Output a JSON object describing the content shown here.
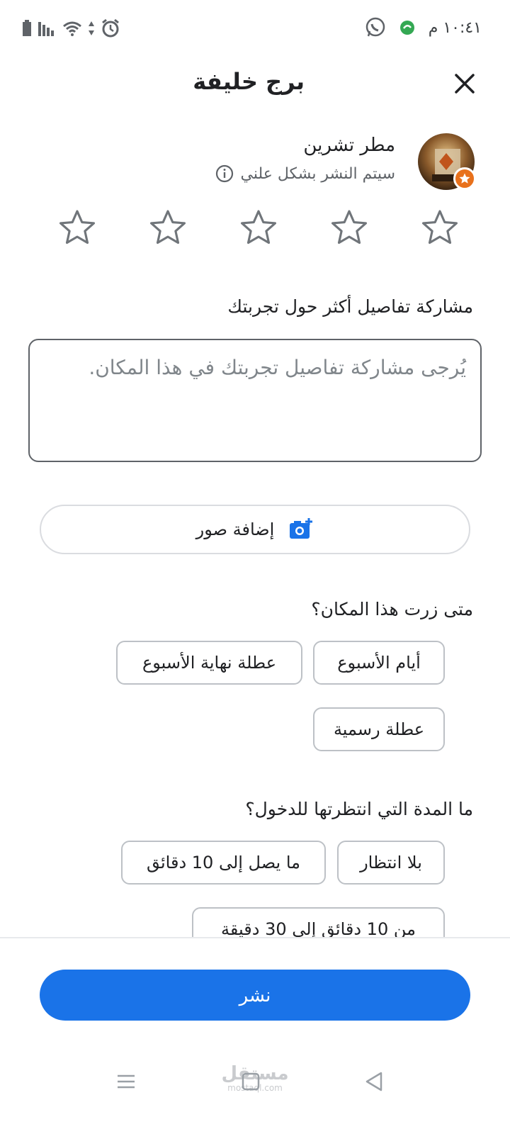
{
  "status_bar": {
    "time": "١٠:٤١ م",
    "icons": [
      "battery-icon",
      "signal-icon",
      "wifi-icon",
      "data-arrows-icon",
      "alarm-icon",
      "whatsapp-icon",
      "app-notification-icon"
    ]
  },
  "header": {
    "title": "برج خليفة",
    "close_icon": "close-icon"
  },
  "profile": {
    "name": "مطر تشرين",
    "post_note": "سيتم النشر بشكل علني",
    "info_icon": "info-icon",
    "badge_icon": "local-guide-star-icon"
  },
  "rating": {
    "max_stars": 5,
    "selected": 0
  },
  "review": {
    "label": "مشاركة تفاصيل أكثر حول تجربتك",
    "placeholder": "يُرجى مشاركة تفاصيل تجربتك في هذا المكان."
  },
  "add_photos": {
    "label": "إضافة صور",
    "icon": "add-photo-icon"
  },
  "visit_time": {
    "question": "متى زرت هذا المكان؟",
    "options": [
      "أيام الأسبوع",
      "عطلة نهاية الأسبوع",
      "عطلة رسمية"
    ]
  },
  "wait_time": {
    "question": "ما المدة التي انتظرتها للدخول؟",
    "options": [
      "بلا انتظار",
      "ما يصل إلى 10 دقائق",
      "من 10 دقائق إلى 30 دقيقة"
    ]
  },
  "publish": {
    "label": "نشر"
  },
  "nav": {
    "icons": [
      "menu-icon",
      "home-square-icon",
      "back-triangle-icon"
    ]
  },
  "watermark": {
    "arabic": "مستقل",
    "latin": "mostaql.com"
  },
  "colors": {
    "accent": "#1a73e8",
    "badge": "#e8711c",
    "text": "#202124",
    "muted": "#5f6368"
  }
}
